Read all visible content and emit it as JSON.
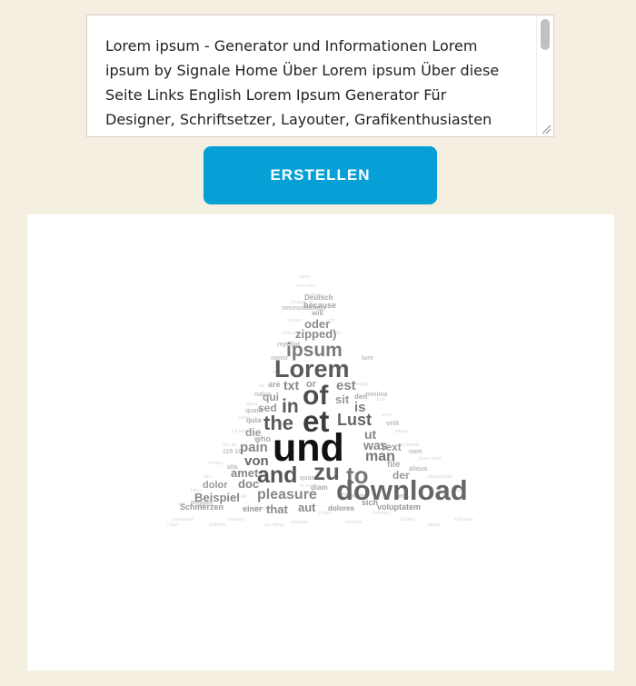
{
  "input": {
    "text": "Lorem ipsum - Generator und Informationen Lorem ipsum by Signale Home Über Lorem ipsum Über diese Seite Links English Lorem Ipsum Generator Für Designer, Schriftsetzer, Layouter, Grafikenthusiasten"
  },
  "button": {
    "label": "ERSTELLEN"
  },
  "colors": {
    "background": "#f4efe0",
    "button": "#06a0d6",
    "panel": "#ffffff"
  },
  "wordcloud": {
    "shape": "triangle",
    "words": [
      "Deutsch",
      "because",
      "will",
      "oder",
      "zipped)",
      "ipsum",
      "Lorem",
      "are",
      "txt",
      "or",
      "est",
      "qui",
      "of",
      "sit",
      "den",
      "sed",
      "in",
      "is",
      "the",
      "et",
      "Lust",
      "quia",
      "ut",
      "who",
      "was",
      "pain",
      "und",
      "Text",
      "die",
      "von",
      "file",
      "amet",
      "doc",
      "zu",
      "to",
      "man",
      "and",
      "der",
      "dolor",
      "diam",
      "Beispiel",
      "pleasure",
      "download",
      "sich",
      "Schmerzen",
      "einer",
      "that",
      "aut",
      "dolores",
      "voluptatem"
    ]
  }
}
